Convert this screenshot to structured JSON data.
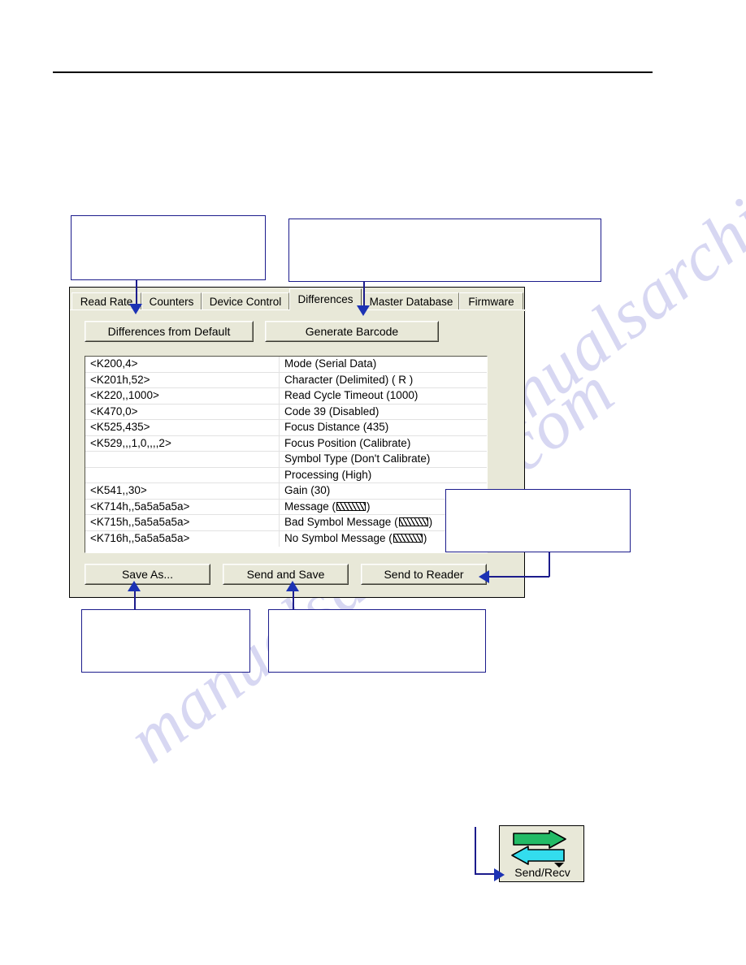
{
  "page": {
    "watermark": "manualsarchive.com"
  },
  "dialog": {
    "tabs": [
      {
        "label": "Read Rate",
        "active": false
      },
      {
        "label": "Counters",
        "active": false
      },
      {
        "label": "Device Control",
        "active": false
      },
      {
        "label": "Differences",
        "active": true
      },
      {
        "label": "Master Database",
        "active": false
      },
      {
        "label": "Firmware",
        "active": false
      }
    ],
    "top_buttons": [
      {
        "name": "differences-from-default-button",
        "pre": "D",
        "rest": "ifferences from Default"
      },
      {
        "name": "generate-barcode-button",
        "pre": "B",
        "rest": "arcode",
        "lead": "Generate "
      }
    ],
    "bottom_buttons": [
      {
        "name": "save-as-button",
        "lead": "S",
        "mnemonic": "S",
        "label": "Save As..."
      },
      {
        "name": "send-and-save-button",
        "label": "Send and Save"
      },
      {
        "name": "send-to-reader-button",
        "label": "Send to Reader"
      }
    ],
    "button_labels": {
      "differences_from_default": "Differences from Default",
      "generate_barcode": "Generate Barcode",
      "save_as": "Save As...",
      "send_and_save": "Send and Save",
      "send_to_reader": "Send to Reader"
    },
    "list": {
      "rows": [
        {
          "command": "<K200,4>",
          "description": "Mode (Serial Data)"
        },
        {
          "command": "<K201h,52>",
          "description": "Character (Delimited) ( R  )"
        },
        {
          "command": "<K220,,1000>",
          "description": "Read Cycle Timeout (1000)"
        },
        {
          "command": "<K470,0>",
          "description": "Code 39 (Disabled)"
        },
        {
          "command": "<K525,435>",
          "description": "Focus Distance (435)"
        },
        {
          "command": "<K529,,,1,0,,,,2>",
          "description": "Focus Position (Calibrate)"
        },
        {
          "command": "",
          "description": "Symbol Type (Don't Calibrate)"
        },
        {
          "command": "",
          "description": "Processing (High)"
        },
        {
          "command": "<K541,,30>",
          "description": "Gain (30)"
        },
        {
          "command": "<K714h,,5a5a5a5a>",
          "description": "Message (",
          "hatch": true,
          "tail": ")"
        },
        {
          "command": "<K715h,,5a5a5a5a>",
          "description": "Bad Symbol Message (",
          "hatch": true,
          "tail": ")"
        },
        {
          "command": "<K716h,,5a5a5a5a>",
          "description": "No Symbol Message (",
          "hatch": true,
          "tail": ")"
        }
      ]
    }
  },
  "callouts": {
    "top_left": "",
    "top_right": "",
    "right": "",
    "bottom_left": "",
    "bottom_middle": ""
  },
  "toolbar_icon": {
    "label": "Send/Recv",
    "send_arrow_color": "#22bb66",
    "recv_arrow_color": "#33ddee",
    "background": "#e8e8d8"
  },
  "colors": {
    "annotation": "#1c1c8c",
    "arrow": "#1c32b4",
    "dialog_face": "#e8e8d8",
    "watermark": "#c9c9ee"
  }
}
